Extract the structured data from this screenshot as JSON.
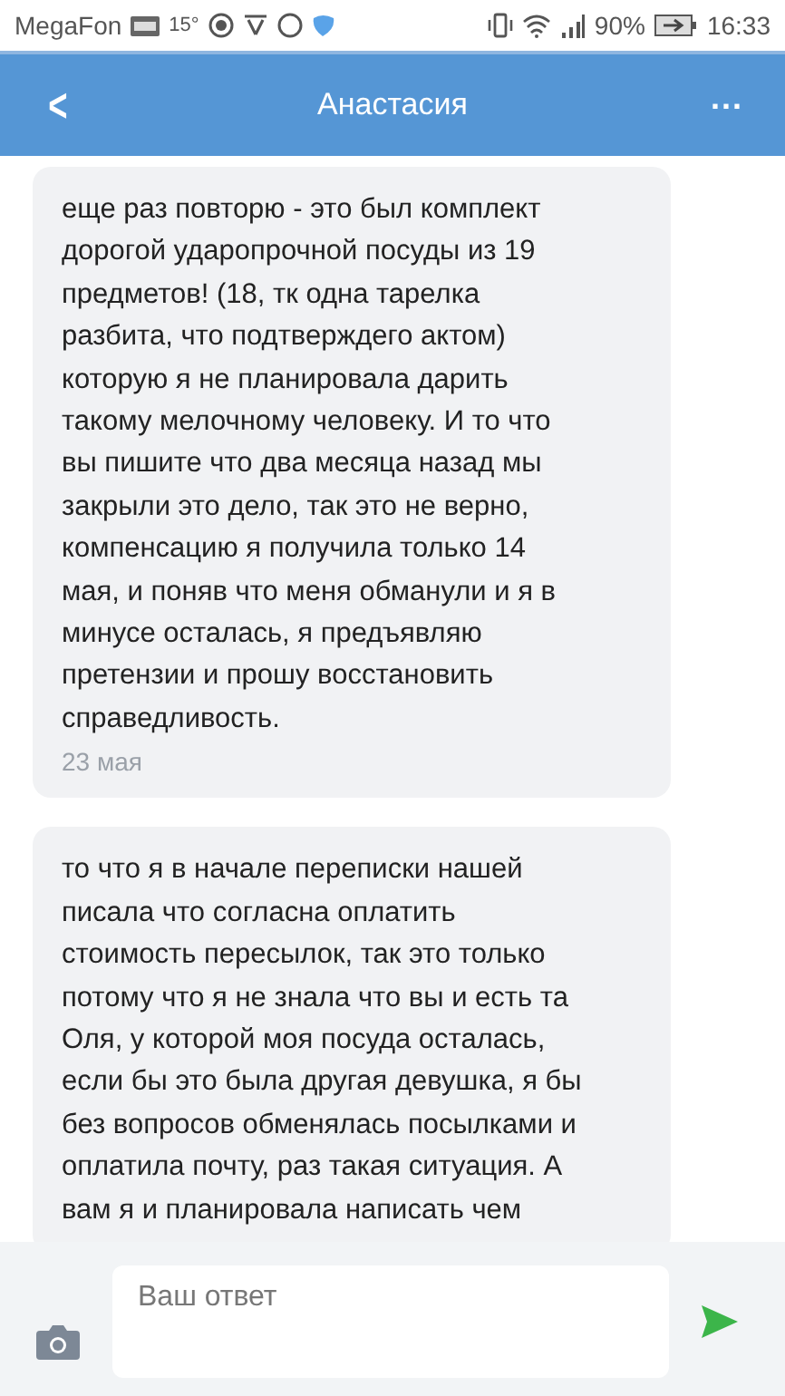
{
  "status_bar": {
    "carrier": "MegaFon",
    "temperature": "15°",
    "battery": "90%",
    "time": "16:33"
  },
  "header": {
    "back": "<",
    "title": "Анастасия",
    "menu": "..."
  },
  "messages": [
    {
      "text": "еще раз повторю - это был комплект\nдорогой ударопрочной посуды из 19\nпредметов! (18, тк одна тарелка\nразбита, что подтверждего актом)\nкоторую я не планировала дарить\nтакому мелочному человеку. И то что\nвы пишите что два месяца назад мы\nзакрыли это дело, так это не верно,\nкомпенсацию я получила только 14\nмая, и поняв что меня обманули и я в\nминусе осталась, я предъявляю\nпретензии и прошу восстановить\nсправедливость.",
      "date": "23 мая"
    },
    {
      "text": "то что я в начале переписки нашей\nписала что согласна оплатить\nстоимость пересылок, так это только\nпотому что я не знала что вы и есть та\nОля, у которой моя посуда осталась,\nесли бы это была другая девушка, я бы\nбез вопросов обменялась посылками и\nоплатила почту, раз такая ситуация. А\nвам я и планировала написать чем"
    }
  ],
  "composer": {
    "placeholder": "Ваш ответ"
  }
}
